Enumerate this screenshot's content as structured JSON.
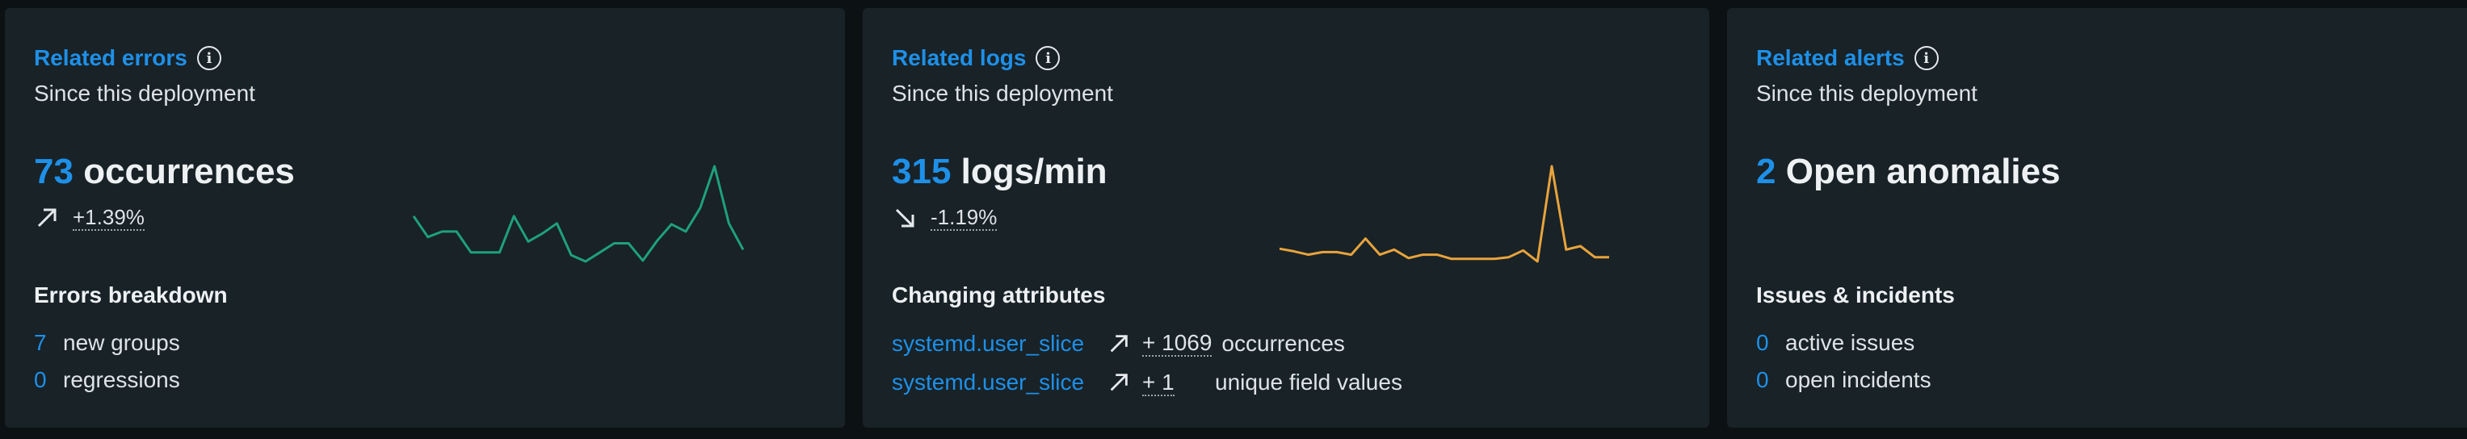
{
  "cards": [
    {
      "title": "Related errors",
      "subtitle": "Since this deployment",
      "metric_value": "73",
      "metric_unit": "occurrences",
      "trend": "+1.39%",
      "trend_direction": "up",
      "section_title": "Errors breakdown",
      "items": [
        {
          "count": "7",
          "label": "new groups"
        },
        {
          "count": "0",
          "label": "regressions"
        }
      ],
      "sparkline": [
        55,
        78,
        72,
        72,
        95,
        95,
        95,
        55,
        83,
        74,
        63,
        98,
        105,
        95,
        85,
        85,
        104,
        82,
        64,
        72,
        46,
        0,
        63,
        92
      ],
      "sparkline_color": "#1fa07e"
    },
    {
      "title": "Related logs",
      "subtitle": "Since this deployment",
      "metric_value": "315",
      "metric_unit": "logs/min",
      "trend": "-1.19%",
      "trend_direction": "down",
      "section_title": "Changing attributes",
      "attributes": [
        {
          "name": "systemd.user_slice",
          "delta": "+ 1069",
          "what": "occurrences"
        },
        {
          "name": "systemd.user_slice",
          "delta": "+ 1",
          "what": "unique field values"
        }
      ],
      "sparkline": [
        97,
        100,
        104,
        101,
        101,
        104,
        85,
        104,
        98,
        108,
        104,
        104,
        109,
        109,
        109,
        109,
        107,
        99,
        112,
        0,
        98,
        94,
        107,
        107
      ],
      "sparkline_color": "#e8a33c"
    },
    {
      "title": "Related alerts",
      "subtitle": "Since this deployment",
      "metric_value": "2",
      "metric_unit": "Open anomalies",
      "section_title": "Issues & incidents",
      "items": [
        {
          "count": "0",
          "label": "active issues"
        },
        {
          "count": "0",
          "label": "open incidents"
        }
      ]
    }
  ]
}
